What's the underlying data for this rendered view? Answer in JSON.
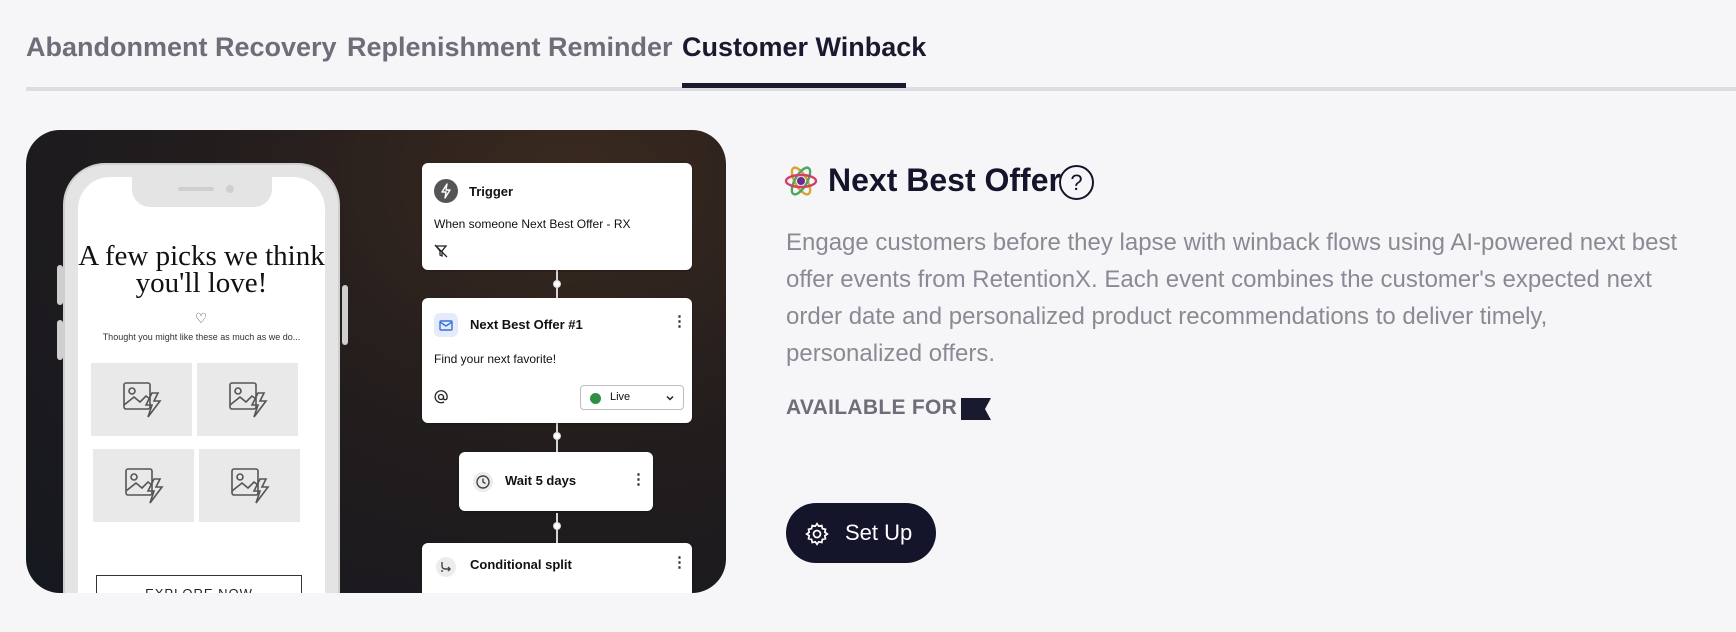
{
  "tabs": [
    {
      "label": "Abandonment Recovery",
      "active": false
    },
    {
      "label": "Replenishment Reminder",
      "active": false
    },
    {
      "label": "Customer Winback",
      "active": true
    }
  ],
  "preview": {
    "phone": {
      "headline": "A few picks we think you'll love!",
      "subtext": "Thought you might like these as much as we do...",
      "button_label": "EXPLORE NOW",
      "heart_icon": "heart-icon",
      "product_tiles": 4
    },
    "flow": {
      "trigger": {
        "title": "Trigger",
        "text": "When someone Next Best Offer - RX"
      },
      "email": {
        "title": "Next Best Offer #1",
        "text": "Find your next favorite!",
        "status": "Live"
      },
      "wait": {
        "title": "Wait 5 days"
      },
      "split": {
        "title": "Conditional split"
      }
    }
  },
  "feature": {
    "title": "Next Best Offer",
    "description": "Engage customers before they lapse with winback flows using AI-powered next best offer events from RetentionX. Each event combines the customer's expected next order date and personalized product recommendations to deliver timely, personalized offers.",
    "available_label": "AVAILABLE FOR",
    "setup_label": "Set Up"
  },
  "colors": {
    "accent": "#14142b",
    "muted_text": "#8a8a94",
    "live_green": "#2f8f46"
  }
}
